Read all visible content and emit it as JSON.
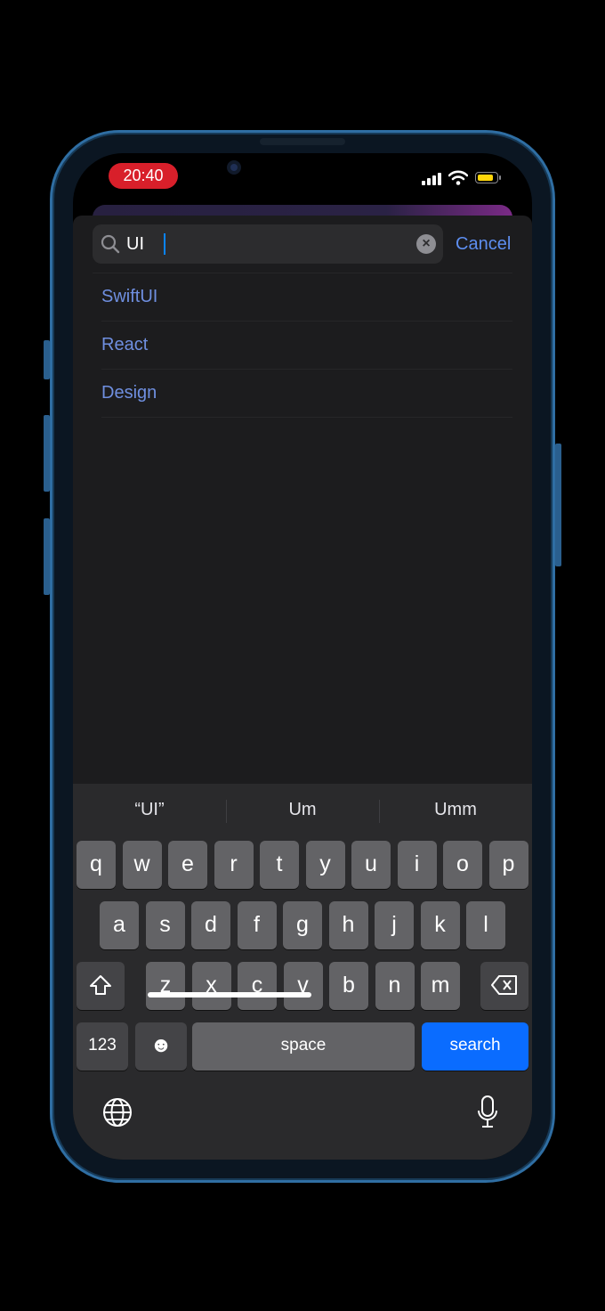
{
  "status_bar": {
    "time": "20:40"
  },
  "search": {
    "query": "UI",
    "cancel_label": "Cancel"
  },
  "suggestions": [
    {
      "label": "SwiftUI"
    },
    {
      "label": "React"
    },
    {
      "label": "Design"
    }
  ],
  "keyboard": {
    "predictions": [
      "“UI”",
      "Um",
      "Umm"
    ],
    "row1": [
      "q",
      "w",
      "e",
      "r",
      "t",
      "y",
      "u",
      "i",
      "o",
      "p"
    ],
    "row2": [
      "a",
      "s",
      "d",
      "f",
      "g",
      "h",
      "j",
      "k",
      "l"
    ],
    "row3": [
      "z",
      "x",
      "c",
      "v",
      "b",
      "n",
      "m"
    ],
    "numbers_label": "123",
    "emoji_label": "☻",
    "space_label": "space",
    "search_label": "search"
  },
  "colors": {
    "accent": "#0a84ff",
    "link": "#6f8fe0",
    "time_pill": "#d81f2a",
    "battery": "#ffd60a"
  }
}
